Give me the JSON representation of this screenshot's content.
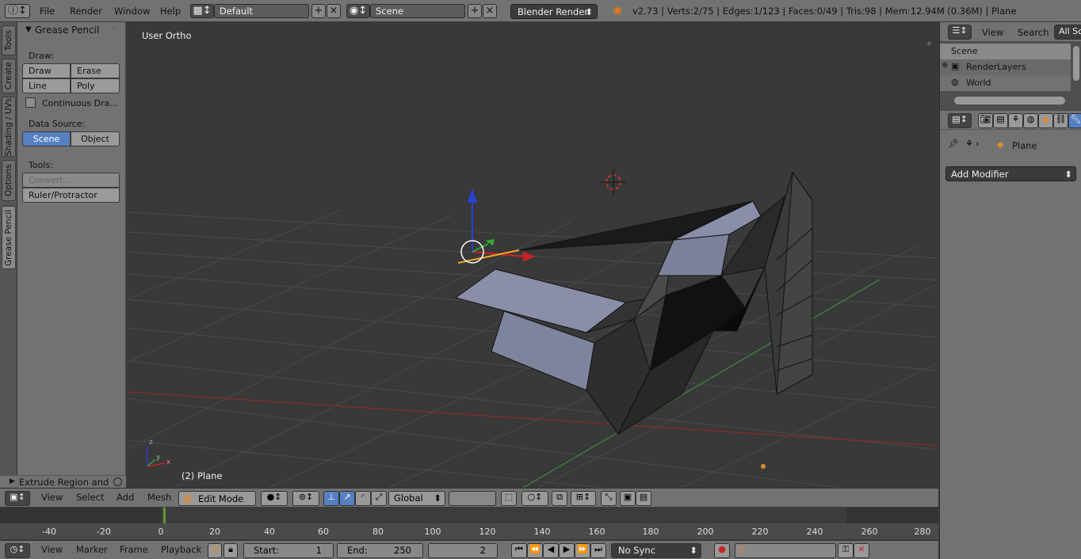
{
  "topbar": {
    "menus": [
      "File",
      "Render",
      "Window",
      "Help"
    ],
    "screen_layout": "Default",
    "scene": "Scene",
    "render_engine": "Blender Render",
    "stats": "v2.73 | Verts:2/75 | Edges:1/123 | Faces:0/49 | Tris:98 | Mem:12.94M (0.36M) | Plane"
  },
  "left_tabs": [
    "Tools",
    "Create",
    "Shading / UVs",
    "Options",
    "Grease Pencil"
  ],
  "tool_panel": {
    "section_title": "Grease Pencil",
    "draw_label": "Draw:",
    "draw_buttons": [
      "Draw",
      "Erase",
      "Line",
      "Poly"
    ],
    "continuous_label": "Continuous Dra...",
    "data_source_label": "Data Source:",
    "data_source_options": [
      "Scene",
      "Object"
    ],
    "tools_label": "Tools:",
    "convert_label": "Convert...",
    "ruler_label": "Ruler/Protractor",
    "operator_panel": "Extrude Region and"
  },
  "viewport": {
    "view_name": "User Ortho",
    "object_label": "(2) Plane",
    "axis_labels": {
      "z": "z",
      "y": "y",
      "x": "x"
    }
  },
  "viewport_header": {
    "menus": [
      "View",
      "Select",
      "Add",
      "Mesh"
    ],
    "mode": "Edit Mode",
    "orientation": "Global"
  },
  "timeline": {
    "ticks": [
      "-40",
      "-20",
      "0",
      "20",
      "40",
      "60",
      "80",
      "100",
      "120",
      "140",
      "160",
      "180",
      "200",
      "220",
      "240",
      "260",
      "280"
    ],
    "current_frame_value": 2
  },
  "timeline_header": {
    "menus": [
      "View",
      "Marker",
      "Frame",
      "Playback"
    ],
    "start_label": "Start:",
    "start_value": "1",
    "end_label": "End:",
    "end_value": "250",
    "current_frame": "2",
    "sync": "No Sync"
  },
  "outliner": {
    "header": {
      "view": "View",
      "search": "Search",
      "filter": "All Sc"
    },
    "items": [
      "Scene",
      "RenderLayers",
      "World"
    ]
  },
  "properties": {
    "object_name": "Plane",
    "add_modifier_label": "Add Modifier"
  },
  "colors": {
    "accent": "#5680c2",
    "selection_orange": "#f5a623",
    "x_axis": "#b33",
    "y_axis": "#3a9a3a",
    "z_axis": "#2a3fd8"
  }
}
